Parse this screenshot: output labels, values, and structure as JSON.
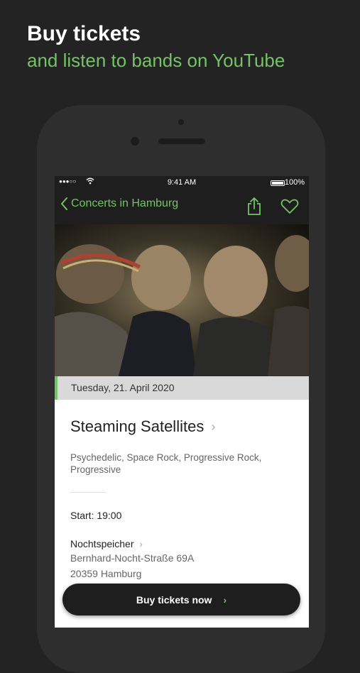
{
  "headline": {
    "line1": "Buy tickets",
    "line2": "and listen to bands on YouTube"
  },
  "status_bar": {
    "signal": "●●●○○",
    "time": "9:41 AM",
    "battery": "100%"
  },
  "nav": {
    "back_label": "Concerts in Hamburg"
  },
  "event": {
    "date": "Tuesday, 21. April 2020",
    "title": "Steaming Satellites",
    "genres": "Psychedelic, Space Rock, Progressive Rock, Progressive",
    "start": "Start: 19:00",
    "venue": "Nochtspeicher",
    "address_line1": "Bernhard-Nocht-Straße 69A",
    "address_line2": "20359 Hamburg"
  },
  "cta": {
    "label": "Buy tickets now"
  },
  "colors": {
    "accent": "#74c365",
    "background": "#232323",
    "nav": "#1e1e1e"
  }
}
